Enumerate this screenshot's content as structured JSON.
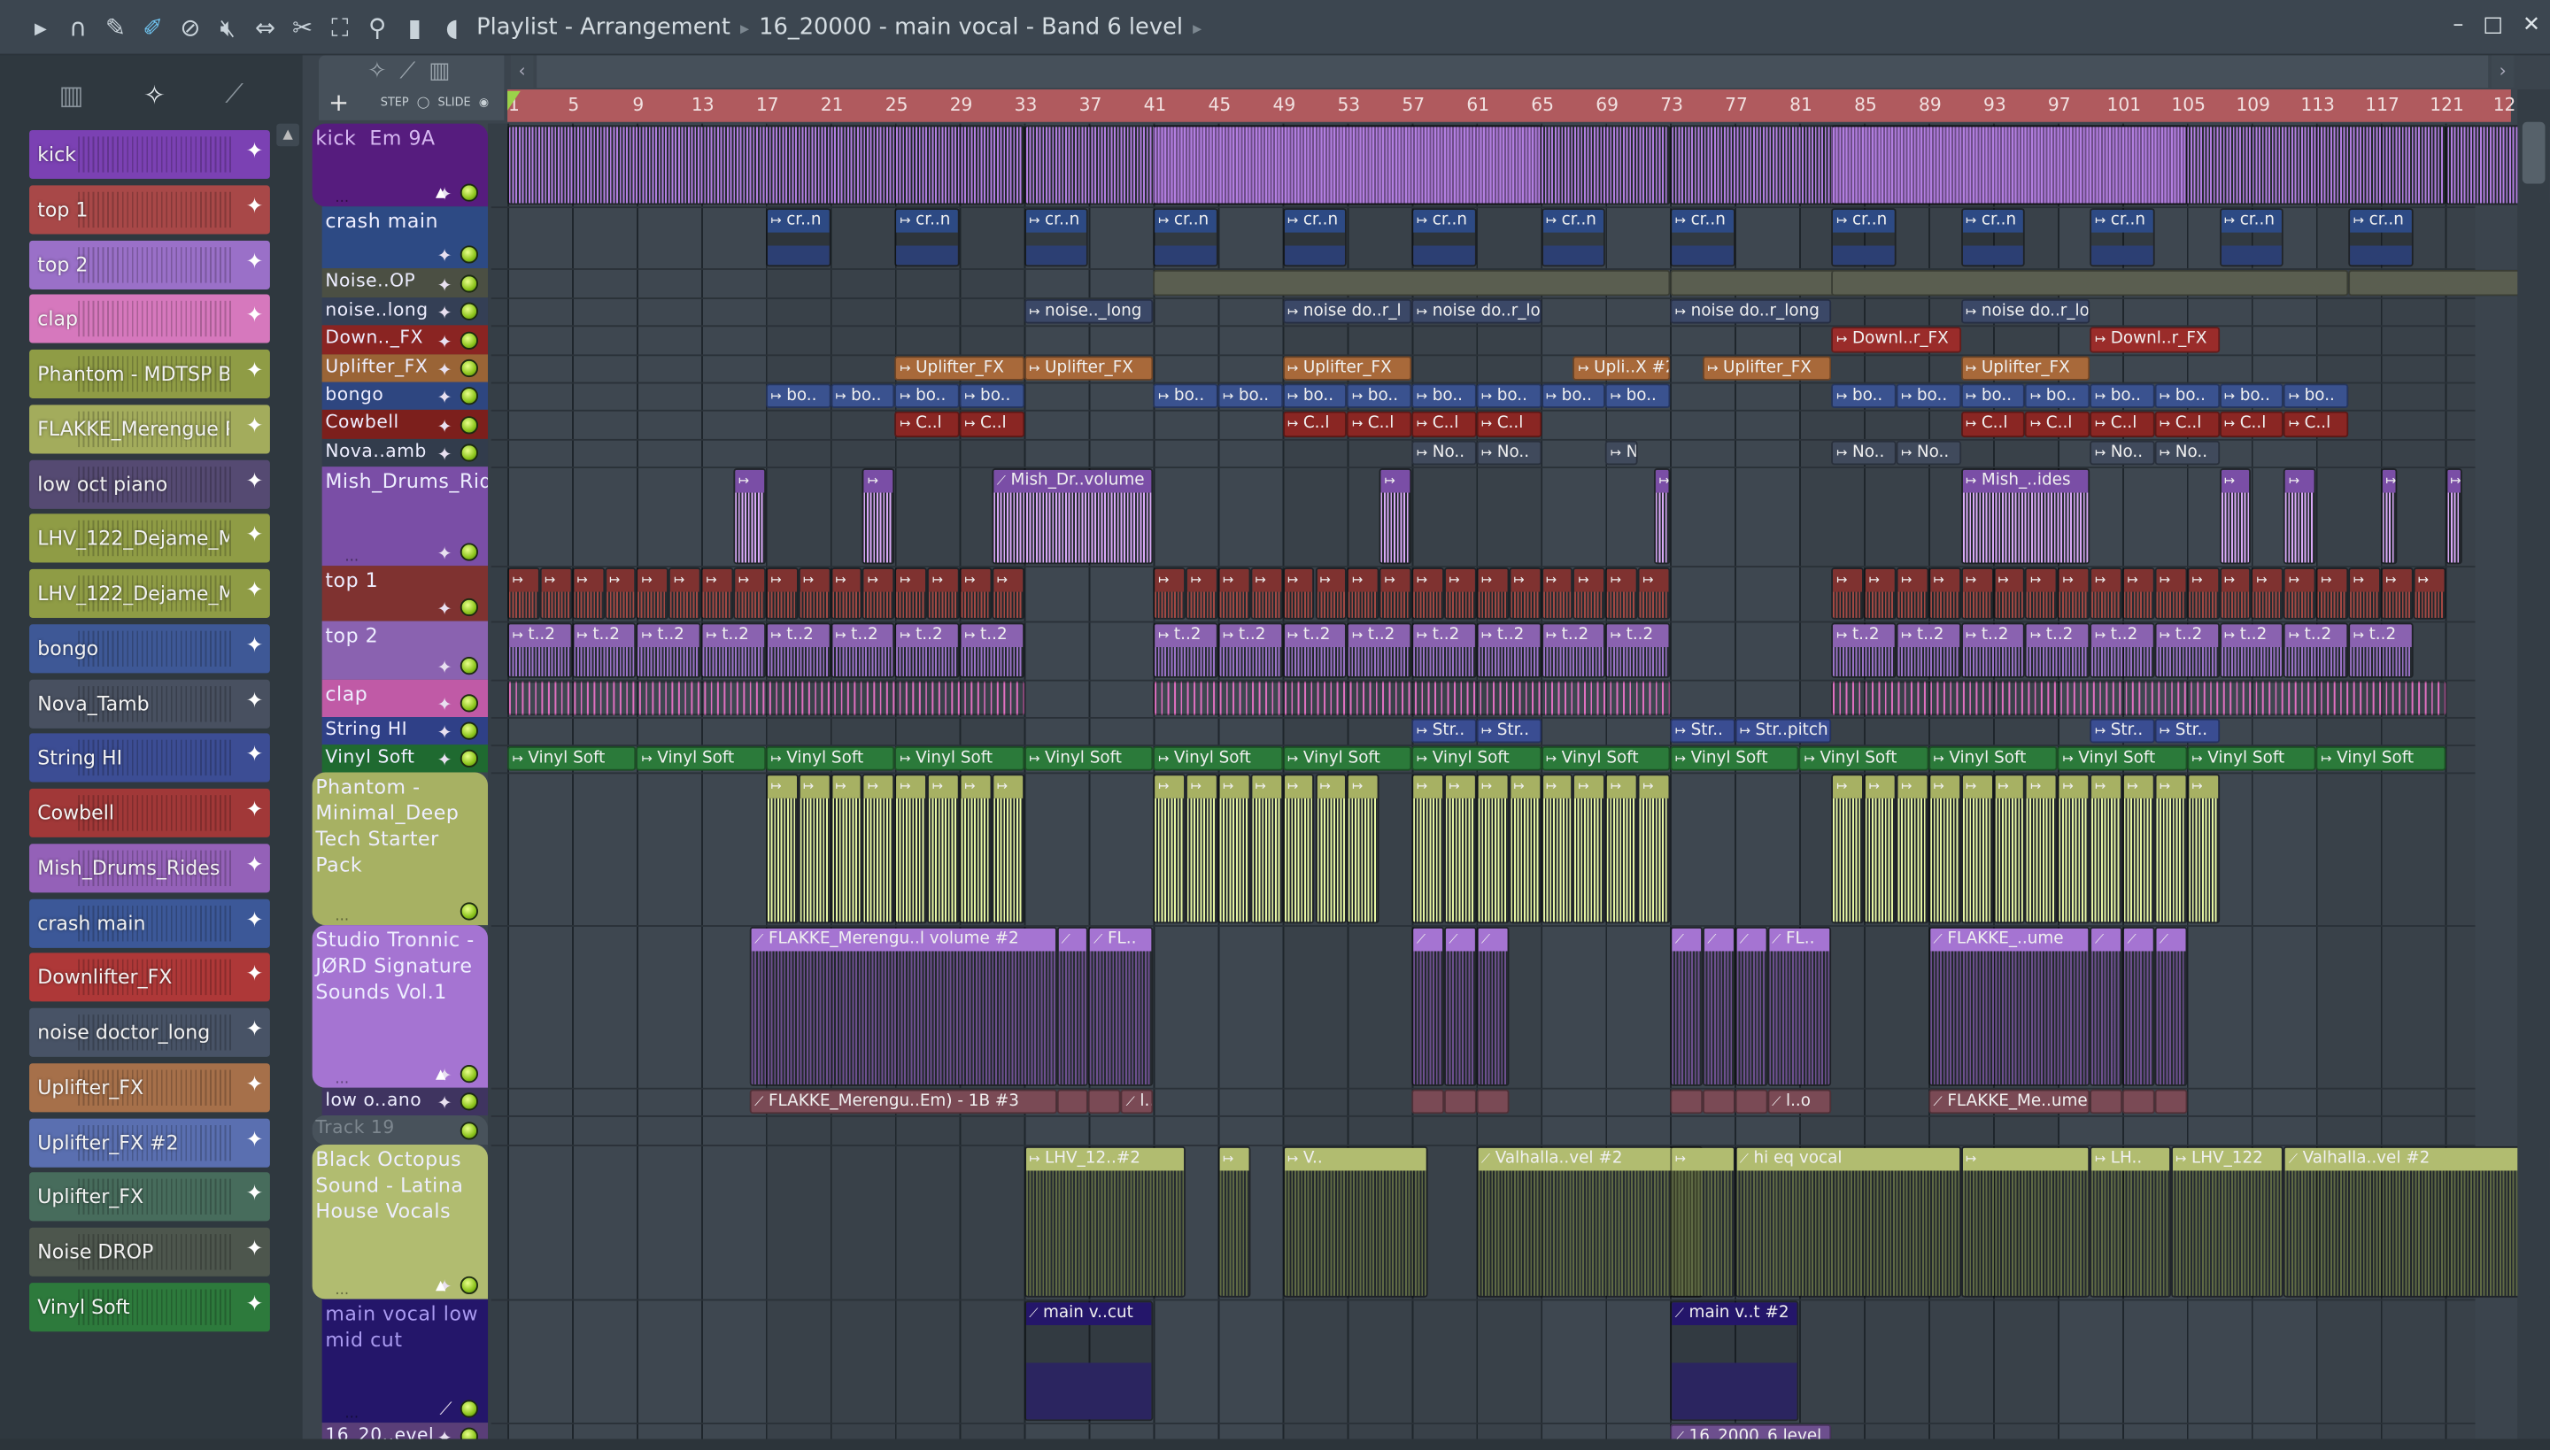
{
  "toolbar": {
    "icons": [
      "play-arrow-icon",
      "magnet-icon",
      "pencil-icon",
      "brush-icon",
      "delete-icon",
      "mute-icon",
      "slip-icon",
      "slice-icon",
      "select-icon",
      "zoom-icon",
      "playback-icon",
      "speaker-icon"
    ],
    "breadcrumb": [
      "Playlist - Arrangement",
      "16_20000 - main vocal - Band 6 level"
    ],
    "window": {
      "minimize": "–",
      "maximize": "□",
      "close": "✕"
    }
  },
  "header_tools": {
    "add": "+",
    "step": "STEP",
    "slide": "SLIDE"
  },
  "ruler": {
    "labels": [
      "1",
      "5",
      "9",
      "13",
      "17",
      "21",
      "25",
      "29",
      "33",
      "37",
      "41",
      "45",
      "49",
      "53",
      "57",
      "61",
      "65",
      "69",
      "73",
      "77",
      "81",
      "85",
      "89",
      "93",
      "97",
      "101",
      "105",
      "109",
      "113",
      "117",
      "121"
    ],
    "partial": "12"
  },
  "channels": [
    {
      "name": "kick",
      "color": "#7b41b3"
    },
    {
      "name": "top 1",
      "color": "#a84848"
    },
    {
      "name": "top 2",
      "color": "#9a70c8"
    },
    {
      "name": "clap",
      "color": "#d678bd"
    },
    {
      "name": "Phantom - MDTSP B..",
      "color": "#8f9c45"
    },
    {
      "name": "FLAKKE_Merengue Pi..",
      "color": "#a3ac5c"
    },
    {
      "name": "low oct piano",
      "color": "#554a72"
    },
    {
      "name": "LHV_122_Dejame_M..",
      "color": "#8f9c45"
    },
    {
      "name": "LHV_122_Dejame_M..",
      "color": "#8f9c45"
    },
    {
      "name": "bongo",
      "color": "#3e5896"
    },
    {
      "name": "Nova_Tamb",
      "color": "#485060"
    },
    {
      "name": "String HI",
      "color": "#3c4d94"
    },
    {
      "name": "Cowbell",
      "color": "#a13838"
    },
    {
      "name": "Mish_Drums_Rides",
      "color": "#9461b8"
    },
    {
      "name": "crash main",
      "color": "#3c5898"
    },
    {
      "name": "Downlifter_FX",
      "color": "#ae3838"
    },
    {
      "name": "noise doctor_long",
      "color": "#485366"
    },
    {
      "name": "Uplifter_FX",
      "color": "#a6704a"
    },
    {
      "name": "Uplifter_FX #2",
      "color": "#5a6fb0"
    },
    {
      "name": "Uplifter_FX",
      "color": "#476c5c"
    },
    {
      "name": "Noise DROP",
      "color": "#4d564d"
    },
    {
      "name": "Vinyl Soft",
      "color": "#2d7a3c"
    }
  ],
  "tracks": [
    {
      "name": "kick  Em 9A",
      "color": "#561c7e",
      "text": "#d7b8f2",
      "big": true,
      "tri": true,
      "clipColor": "#b27ee0",
      "clips": [
        {
          "from": 1,
          "to": 33,
          "step": 32,
          "label": ""
        },
        {
          "from": 41,
          "to": 73,
          "step": 32,
          "label": ""
        },
        {
          "from": 83,
          "to": 121,
          "step": 38,
          "label": ""
        }
      ]
    },
    {
      "name": "crash main",
      "color": "#2d4a84",
      "clipColor": "#2c3f73",
      "clips": [
        {
          "from": 17,
          "to": 73,
          "step": 8,
          "len": 4,
          "label": "cr..n"
        },
        {
          "from": 83,
          "to": 115,
          "step": 8,
          "len": 4,
          "label": "cr..n"
        }
      ]
    },
    {
      "name": "Noise..OP",
      "color": "#4b4f43",
      "small": true,
      "clipColor": "#5a5e50",
      "clips": [
        {
          "from": 41,
          "to": 73,
          "step": 32,
          "label": ""
        },
        {
          "from": 83,
          "to": 115,
          "step": 32,
          "label": ""
        }
      ]
    },
    {
      "name": "noise..long",
      "color": "#343f55",
      "small": true,
      "clipColor": "#3b4867",
      "clips": [
        {
          "from": 33,
          "len": 8,
          "label": "noise.._long"
        },
        {
          "from": 49,
          "len": 8,
          "label": "noise do..r_l"
        },
        {
          "from": 57,
          "len": 8,
          "label": "noise do..r_long"
        },
        {
          "from": 73,
          "len": 10,
          "label": "noise do..r_long"
        },
        {
          "from": 91,
          "len": 8,
          "label": "noise do..r_long"
        }
      ]
    },
    {
      "name": "Down.._FX",
      "color": "#8a2422",
      "small": true,
      "clipColor": "#9a2c2a",
      "clips": [
        {
          "from": 83,
          "len": 8,
          "label": "Downl..r_FX"
        },
        {
          "from": 99,
          "len": 8,
          "label": "Downl..r_FX"
        }
      ]
    },
    {
      "name": "Uplifter_FX",
      "color": "#9a6436",
      "small": true,
      "clipColor": "#a8693a",
      "clips": [
        {
          "from": 25,
          "len": 8,
          "label": "Uplifter_FX"
        },
        {
          "from": 33,
          "len": 8,
          "label": "Uplifter_FX"
        },
        {
          "from": 49,
          "len": 8,
          "label": "Uplifter_FX"
        },
        {
          "from": 67,
          "len": 6,
          "label": "Upli..X #2"
        },
        {
          "from": 75,
          "len": 8,
          "label": "Uplifter_FX"
        },
        {
          "from": 91,
          "len": 8,
          "label": "Uplifter_FX"
        }
      ]
    },
    {
      "name": "bongo",
      "color": "#2e4680",
      "small": true,
      "clipColor": "#3a528f",
      "clips": [
        {
          "from": 17,
          "to": 31,
          "step": 4,
          "len": 4,
          "label": "bo.."
        },
        {
          "from": 41,
          "to": 71,
          "step": 4,
          "len": 4,
          "label": "bo.."
        },
        {
          "from": 83,
          "to": 113,
          "step": 4,
          "len": 4,
          "label": "bo.."
        }
      ]
    },
    {
      "name": "Cowbell",
      "color": "#7c1f1c",
      "small": true,
      "clipColor": "#8a2623",
      "clips": [
        {
          "from": 25,
          "to": 29,
          "step": 4,
          "len": 4,
          "label": "C..l"
        },
        {
          "from": 49,
          "to": 61,
          "step": 4,
          "len": 4,
          "label": "C..l"
        },
        {
          "from": 91,
          "to": 113,
          "step": 4,
          "len": 4,
          "label": "C..l"
        }
      ]
    },
    {
      "name": "Nova..amb",
      "color": "#323c4c",
      "small": true,
      "clipColor": "#404a5c",
      "clips": [
        {
          "from": 57,
          "to": 61,
          "step": 4,
          "len": 4,
          "label": "No.."
        },
        {
          "from": 69,
          "len": 2,
          "label": "N.."
        },
        {
          "from": 83,
          "to": 87,
          "step": 4,
          "len": 4,
          "label": "No.."
        },
        {
          "from": 99,
          "to": 103,
          "step": 4,
          "len": 4,
          "label": "No.."
        }
      ]
    },
    {
      "name": "Mish_Drums_Rid..",
      "color": "#7a4ea6",
      "clipColor": "#d9a8f7",
      "clips": [
        {
          "from": 15,
          "len": 2,
          "label": ""
        },
        {
          "from": 23,
          "len": 2,
          "label": ""
        },
        {
          "from": 31,
          "len": 10,
          "label": "Mish_Dr..volume"
        },
        {
          "from": 55,
          "len": 2,
          "label": ""
        },
        {
          "from": 72,
          "len": 1,
          "label": ""
        },
        {
          "from": 91,
          "len": 8,
          "label": "Mish_..ides"
        },
        {
          "from": 107,
          "len": 2,
          "label": ""
        },
        {
          "from": 111,
          "len": 2,
          "label": ""
        },
        {
          "from": 117,
          "len": 1,
          "label": ""
        },
        {
          "from": 121,
          "len": 1,
          "label": ""
        }
      ]
    },
    {
      "name": "top 1",
      "color": "#7f3230",
      "clipColor": "#a24843",
      "clips": [
        {
          "from": 1,
          "to": 31,
          "step": 2,
          "len": 2,
          "label": ""
        },
        {
          "from": 41,
          "to": 71,
          "step": 2,
          "len": 2,
          "label": ""
        },
        {
          "from": 83,
          "to": 119,
          "step": 2,
          "len": 2,
          "label": ""
        }
      ]
    },
    {
      "name": "top 2",
      "color": "#8a62b0",
      "clipColor": "#9a72c6",
      "clips": [
        {
          "from": 1,
          "to": 29,
          "step": 4,
          "len": 4,
          "label": "t..2"
        },
        {
          "from": 41,
          "to": 53,
          "step": 4,
          "len": 4,
          "label": "t..2"
        },
        {
          "from": 57,
          "to": 69,
          "step": 4,
          "len": 4,
          "label": "t..2"
        },
        {
          "from": 83,
          "to": 117,
          "step": 4,
          "len": 4,
          "label": "t..2"
        }
      ]
    },
    {
      "name": "clap",
      "color": "#c05aa6",
      "clipColor": "#d66cba",
      "clips": [
        {
          "from": 1,
          "to": 1,
          "step": 32,
          "len": 32,
          "label": ""
        },
        {
          "from": 41,
          "len": 32,
          "label": ""
        },
        {
          "from": 83,
          "len": 38,
          "label": ""
        }
      ]
    },
    {
      "name": "String HI",
      "color": "#2f4087",
      "small": true,
      "clipColor": "#3a4d92",
      "clips": [
        {
          "from": 57,
          "to": 61,
          "step": 4,
          "len": 4,
          "label": "Str.."
        },
        {
          "from": 73,
          "len": 4,
          "label": "Str.."
        },
        {
          "from": 77,
          "len": 6,
          "label": "Str..pitch"
        },
        {
          "from": 99,
          "to": 103,
          "step": 4,
          "len": 4,
          "label": "Str.."
        }
      ]
    },
    {
      "name": "Vinyl Soft",
      "color": "#1f6a30",
      "small": true,
      "clipColor": "#2b7a3a",
      "clips": [
        {
          "from": 1,
          "to": 113,
          "step": 8,
          "len": 8,
          "label": "Vinyl Soft"
        }
      ]
    },
    {
      "name": "Phantom -\nMinimal_Deep\nTech Starter Pack",
      "color": "#a7b163",
      "big": true,
      "clipColor": "#e6f5a2",
      "clips": [
        {
          "from": 17,
          "to": 31,
          "step": 2,
          "len": 2,
          "label": ""
        },
        {
          "from": 41,
          "to": 53,
          "step": 2,
          "len": 2,
          "label": ""
        },
        {
          "from": 57,
          "to": 71,
          "step": 2,
          "len": 2,
          "label": ""
        },
        {
          "from": 83,
          "to": 105,
          "step": 2,
          "len": 2,
          "label": ""
        }
      ]
    },
    {
      "name": "Studio Tronnic -\nJØRD Signature\nSounds Vol.1",
      "color": "#a574d2",
      "big": true,
      "tri": true,
      "clipColor": "#6d4f8e",
      "clips": [
        {
          "from": 16,
          "len": 19,
          "label": "FLAKKE_Merengu..l volume #2"
        },
        {
          "from": 35,
          "len": 2,
          "label": ""
        },
        {
          "from": 37,
          "len": 4,
          "label": "FL.."
        },
        {
          "from": 57,
          "to": 61,
          "step": 2,
          "len": 2,
          "label": ""
        },
        {
          "from": 73,
          "to": 77,
          "step": 2,
          "len": 2,
          "label": ""
        },
        {
          "from": 79,
          "len": 4,
          "label": "FL.."
        },
        {
          "from": 89,
          "len": 10,
          "label": "FLAKKE_..ume"
        },
        {
          "from": 99,
          "to": 103,
          "step": 2,
          "len": 2,
          "label": ""
        }
      ]
    },
    {
      "name": "low o..ano",
      "color": "#3f3460",
      "small": true,
      "clipColor": "#7a4a55",
      "clips": [
        {
          "from": 16,
          "len": 19,
          "label": "FLAKKE_Merengu..Em) - 1B #3"
        },
        {
          "from": 35,
          "to": 37,
          "step": 2,
          "len": 2,
          "label": ""
        },
        {
          "from": 39,
          "len": 2,
          "label": "l..o"
        },
        {
          "from": 57,
          "to": 61,
          "step": 2,
          "len": 2,
          "label": ""
        },
        {
          "from": 73,
          "to": 77,
          "step": 2,
          "len": 2,
          "label": ""
        },
        {
          "from": 79,
          "len": 4,
          "label": "l..o"
        },
        {
          "from": 89,
          "len": 10,
          "label": "FLAKKE_Me..ume"
        },
        {
          "from": 99,
          "to": 103,
          "step": 2,
          "len": 2,
          "label": ""
        }
      ]
    },
    {
      "name": "Track 19",
      "color": "#48525b",
      "text": "#7d878f",
      "small": true,
      "big": true,
      "clipColor": "#555",
      "clips": []
    },
    {
      "name": "Black Octopus\nSound - Latina\nHouse Vocals",
      "color": "#b1bc70",
      "big": true,
      "tri": true,
      "clipColor": "#5f6a44",
      "clips": [
        {
          "from": 33,
          "len": 10,
          "label": "LHV_12..#2"
        },
        {
          "from": 45,
          "len": 2,
          "label": ""
        },
        {
          "from": 49,
          "len": 9,
          "label": "V.."
        },
        {
          "from": 61,
          "len": 14,
          "label": "Valhalla..vel #2"
        },
        {
          "from": 73,
          "len": 4,
          "label": ""
        },
        {
          "from": 77,
          "len": 14,
          "label": "hi eq vocal"
        },
        {
          "from": 91,
          "len": 8,
          "label": ""
        },
        {
          "from": 99,
          "len": 5,
          "label": "LH.."
        },
        {
          "from": 104,
          "len": 7,
          "label": "LHV_122"
        },
        {
          "from": 111,
          "len": 17,
          "label": "Valhalla..vel #2"
        }
      ]
    },
    {
      "name": "main vocal low\nmid cut",
      "color": "#24166a",
      "text": "#a99af0",
      "clipColor": "#2b2560",
      "clips": [
        {
          "from": 33,
          "len": 8,
          "label": "main v..cut"
        },
        {
          "from": 73,
          "len": 8,
          "label": "main v..t #2"
        }
      ]
    },
    {
      "name": "16_20..evel",
      "color": "#5a3e78",
      "small": true,
      "clipColor": "#6d4f8e",
      "clips": [
        {
          "from": 73,
          "len": 10,
          "label": "16_2000_6 level"
        }
      ]
    }
  ]
}
